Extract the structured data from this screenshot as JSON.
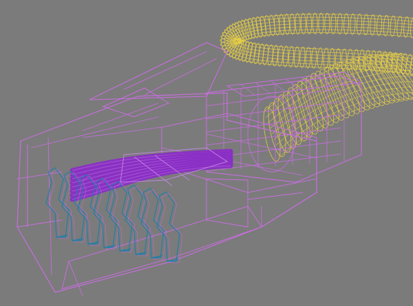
{
  "scene": {
    "subject": "rj45-connector-wireframe",
    "colors": {
      "background": "#7b7b7b",
      "cable": "#e6cf45",
      "housing": "#c86ee0",
      "wires": "#8a2fc4",
      "contacts": "#1f7fa8"
    },
    "contact_count": 8
  }
}
